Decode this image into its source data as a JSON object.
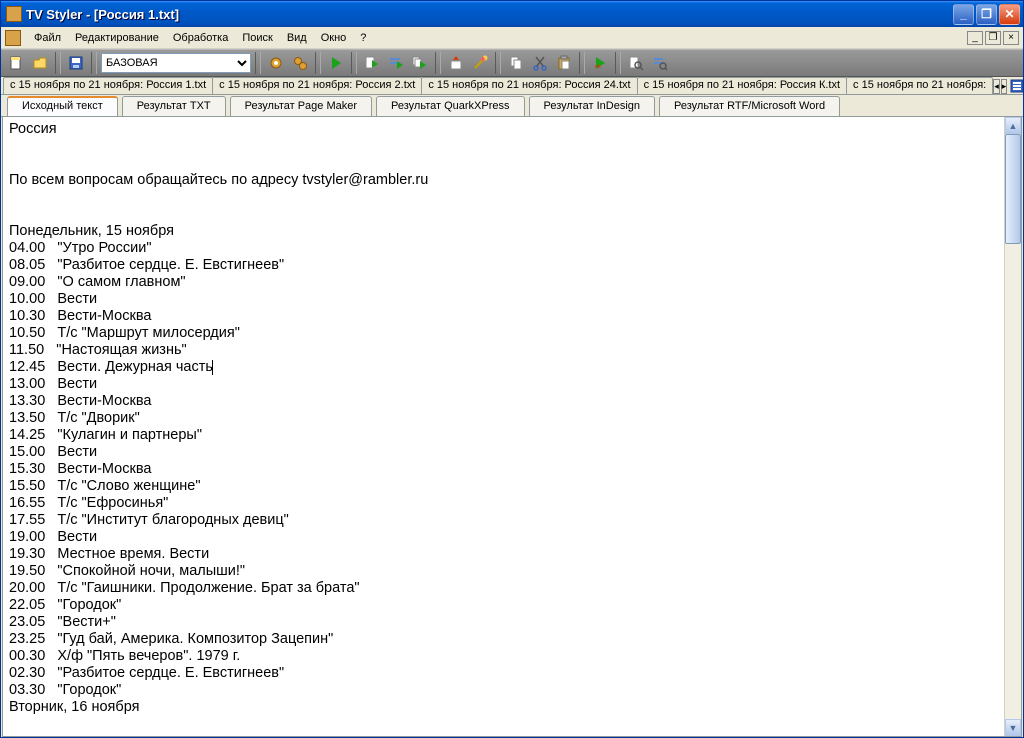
{
  "window": {
    "title": "TV Styler - [Россия 1.txt]"
  },
  "menu": {
    "items": [
      "Файл",
      "Редактирование",
      "Обработка",
      "Поиск",
      "Вид",
      "Окно",
      "?"
    ]
  },
  "toolbar": {
    "combo_selected": "БАЗОВАЯ"
  },
  "doc_tabs": {
    "items": [
      "с 15 ноября по 21 ноября: Россия 1.txt",
      "с 15 ноября по 21 ноября: Россия 2.txt",
      "с 15 ноября по 21 ноября: Россия 24.txt",
      "с 15 ноября по 21 ноября: Россия К.txt",
      "с 15 ноября по 21 ноября:"
    ]
  },
  "view_tabs": {
    "items": [
      "Исходный текст",
      "Результат TXT",
      "Результат Page Maker",
      "Результат QuarkXPress",
      "Результат InDesign",
      "Результат RTF/Microsoft Word"
    ],
    "active": 0
  },
  "editor": {
    "channel": "Россия",
    "contact": "По всем вопросам обращайтесь по адресу tvstyler@rambler.ru",
    "day_header": "Понедельник, 15 ноября",
    "schedule": [
      "04.00   \"Утро России\"",
      "08.05   \"Разбитое сердце. Е. Евстигнеев\"",
      "09.00   \"О самом главном\"",
      "10.00   Вести",
      "10.30   Вести-Москва",
      "10.50   Т/с \"Маршрут милосердия\"",
      "11.50   \"Настоящая жизнь\"",
      "12.45   Вести. Дежурная часть",
      "13.00   Вести",
      "13.30   Вести-Москва",
      "13.50   Т/с \"Дворик\"",
      "14.25   \"Кулагин и партнеры\"",
      "15.00   Вести",
      "15.30   Вести-Москва",
      "15.50   Т/с \"Слово женщине\"",
      "16.55   Т/с \"Ефросинья\"",
      "17.55   Т/с \"Институт благородных девиц\"",
      "19.00   Вести",
      "19.30   Местное время. Вести",
      "19.50   \"Спокойной ночи, малыши!\"",
      "20.00   Т/с \"Гаишники. Продолжение. Брат за брата\"",
      "22.05   \"Городок\"",
      "23.05   \"Вести+\"",
      "23.25   \"Гуд бай, Америка. Композитор Зацепин\"",
      "00.30   Х/ф \"Пять вечеров\". 1979 г.",
      "02.30   \"Разбитое сердце. Е. Евстигнеев\"",
      "03.30   \"Городок\""
    ],
    "next_day": "Вторник, 16 ноября",
    "cursor_line_index": 7
  }
}
